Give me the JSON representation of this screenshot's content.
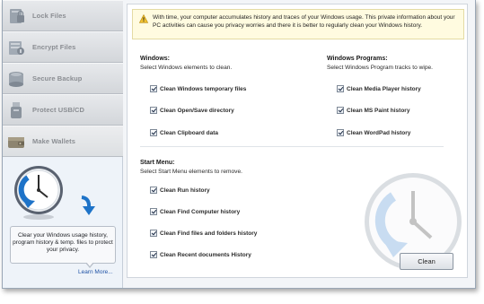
{
  "sidebar": {
    "items": [
      {
        "label": "Lock Files",
        "icon": "lock-files-icon"
      },
      {
        "label": "Encrypt Files",
        "icon": "encrypt-files-icon"
      },
      {
        "label": "Secure Backup",
        "icon": "secure-backup-icon"
      },
      {
        "label": "Protect USB/CD",
        "icon": "protect-usb-icon"
      },
      {
        "label": "Make Wallets",
        "icon": "make-wallets-icon"
      }
    ],
    "info_text": "Clear your Windows usage history, program history & temp. files to protect your privacy.",
    "learn_more": "Learn More..."
  },
  "main": {
    "warning": "With time, your computer accumulates history and traces of your Windows usage. This private information about your PC activities can cause you privacy worries and there it is better to regularly clean your Windows history.",
    "windows": {
      "title": "Windows:",
      "subtitle": "Select Windows elements to clean.",
      "options": [
        "Clean Windows temporary files",
        "Clean Open/Save directory",
        "Clean Clipboard data"
      ]
    },
    "programs": {
      "title": "Windows Programs:",
      "subtitle": "Select Windows Program tracks to wipe.",
      "options": [
        "Clean Media Player history",
        "Clean MS Paint history",
        "Clean WordPad history"
      ]
    },
    "start_menu": {
      "title": "Start Menu:",
      "subtitle": "Select Start Menu elements to remove.",
      "options": [
        "Clean Run history",
        "Clean Find Computer history",
        "Clean Find files and folders history",
        "Clean Recent documents History"
      ]
    },
    "clean_button": "Clean"
  },
  "colors": {
    "accent_blue": "#1e73c8",
    "link": "#1f53a6",
    "warning_bg": "#fffbe0"
  }
}
